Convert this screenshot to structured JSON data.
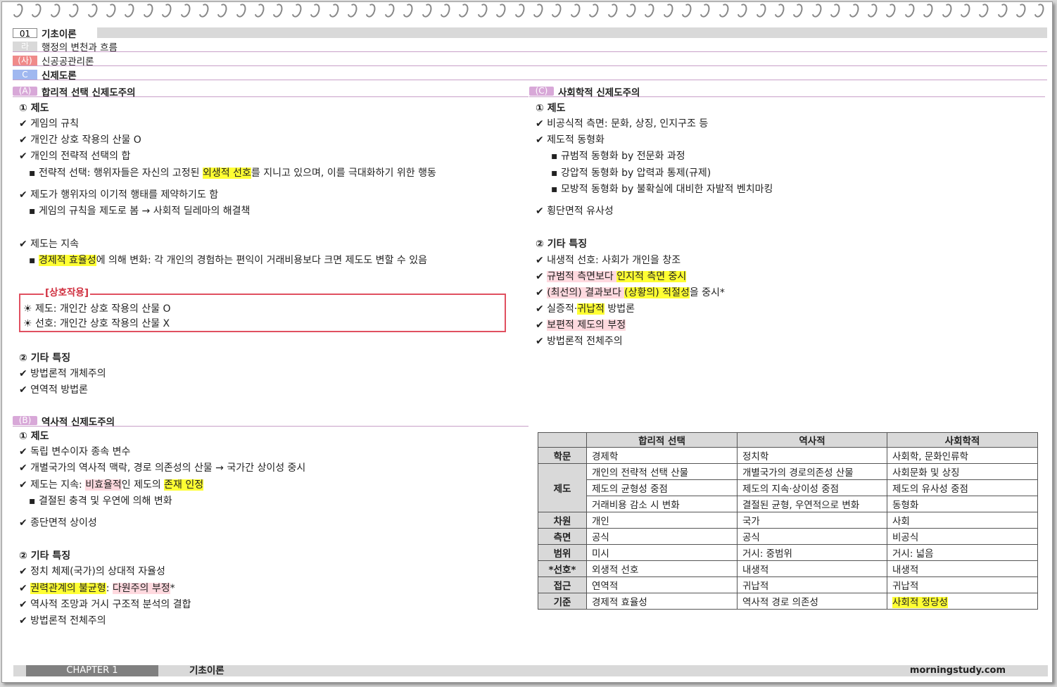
{
  "header": {
    "chapter_num": "01",
    "chapter_title": "기초이론",
    "sub1_tag": "라",
    "sub1_title": "행정의 변천과 흐름",
    "sub2_tag": "(사)",
    "sub2_title": "신공공관리론",
    "sub3_tag": "C",
    "sub3_title": "신제도론"
  },
  "left": {
    "a_tag": "(A)",
    "a_title": "합리적 선택 신제도주의",
    "a_h1": "① 제도",
    "a_l1": "✔ 게임의 규칙",
    "a_l2": "✔ 개인간 상호 작용의 산물 O",
    "a_l3": "✔ 개인의 전략적 선택의 합",
    "a_l4a": "▪ 전략적 선택: 행위자들은 자신의 고정된 ",
    "a_l4b": "외생적 선호",
    "a_l4c": "를 지니고 있으며, 이를 극대화하기 위한 행동",
    "a_l5": "✔ 제도가 행위자의 이기적 행태를 제약하기도 함",
    "a_l6": "▪ 게임의 규칙을 제도로 봄 → 사회적 딜레마의 해결책",
    "a_l7": "✔ 제도는 지속",
    "a_l8a": "▪ ",
    "a_l8b": "경제적 효율성",
    "a_l8c": "에 의해 변화: 각 개인의 경험하는 편익이 거래비용보다 크면 제도도 변할 수 있음",
    "box_title": "[상호작용]",
    "box_l1": "☀ 제도: 개인간 상호 작용의 산물 O",
    "box_l2": "☀ 선호: 개인간 상호 작용의 산물 X",
    "a_h2": "② 기타 특징",
    "a_l9": "✔ 방법론적 개체주의",
    "a_l10": "✔ 연역적 방법론",
    "b_tag": "(B)",
    "b_title": "역사적 신제도주의",
    "b_h1": "① 제도",
    "b_l1": "✔ 독립 변수이자 종속 변수",
    "b_l2": "✔ 개별국가의 역사적 맥락, 경로 의존성의 산물 → 국가간 상이성 중시",
    "b_l3a": "✔ 제도는 지속: ",
    "b_l3b": "비효율적",
    "b_l3c": "인 제도의 ",
    "b_l3d": "존재 인정",
    "b_l4": "▪ 결절된 충격 및 우연에 의해 변화",
    "b_l5": "✔ 종단면적 상이성",
    "b_h2": "② 기타 특징",
    "b_l6": "✔ 정치 체제(국가)의 상대적 자율성",
    "b_l7a": "✔ ",
    "b_l7b": "권력관계의 불균형",
    "b_l7c": ": ",
    "b_l7d": "다원주의 부정",
    "b_l7e": "*",
    "b_l8": "✔ 역사적 조망과 거시 구조적 분석의 결합",
    "b_l9": "✔ 방법론적 전체주의"
  },
  "right": {
    "c_tag": "(C)",
    "c_title": "사회학적 신제도주의",
    "c_h1": "① 제도",
    "c_l1": "✔ 비공식적 측면: 문화, 상징, 인지구조 등",
    "c_l2": "✔ 제도적 동형화",
    "c_l3": "▪ 규범적 동형화 by 전문화 과정",
    "c_l4": "▪ 강압적 동형화 by 압력과 통제(규제)",
    "c_l5": "▪ 모방적 동형화 by 불확실에 대비한 자발적 벤치마킹",
    "c_l6": "✔ 횡단면적 유사성",
    "c_h2": "② 기타 특징",
    "c_l7": "✔ 내생적 선호: 사회가 개인을 창조",
    "c_l8a": "✔ ",
    "c_l8b": "규범적 측면보다 ",
    "c_l8c": "인지적 측면 중시",
    "c_l9a": "✔ ",
    "c_l9b": "(최선의) 결과보다 ",
    "c_l9c": "(상황의) 적절성",
    "c_l9d": "을 중시*",
    "c_l10a": "✔ 실증적·",
    "c_l10b": "귀납적",
    "c_l10c": " 방법론",
    "c_l11a": "✔ ",
    "c_l11b": "보편적 제도의 부정",
    "c_l12": "✔ 방법론적 전체주의"
  },
  "table": {
    "headers": [
      "",
      "합리적 선택",
      "역사적",
      "사회학적"
    ],
    "r_hakmun": [
      "학문",
      "경제학",
      "정치학",
      "사회학, 문화인류학"
    ],
    "r_jedo_label": "제도",
    "r_jedo1": [
      "개인의 전략적 선택 산물",
      "개별국가의 경로의존성 산물",
      "사회문화 및 상징"
    ],
    "r_jedo2": [
      "제도의 균형성 중점",
      "제도의 지속·상이성 중점",
      "제도의 유사성 중점"
    ],
    "r_jedo3": [
      "거래비용 감소 시 변화",
      "결절된 균형, 우연적으로 변화",
      "동형화"
    ],
    "r_chawon": [
      "차원",
      "개인",
      "국가",
      "사회"
    ],
    "r_cheukmyeon": [
      "측면",
      "공식",
      "공식",
      "비공식"
    ],
    "r_beomwi": [
      "범위",
      "미시",
      "거시: 중범위",
      "거시: 넓음"
    ],
    "r_seonho": [
      "*선호*",
      "외생적 선호",
      "내생적",
      "내생적"
    ],
    "r_jeopgeun": [
      "접근",
      "연역적",
      "귀납적",
      "귀납적"
    ],
    "r_gijun": [
      "기준",
      "경제적 효율성",
      "역사적 경로 의존성",
      "사회적 정당성"
    ]
  },
  "footer": {
    "chapter": "CHAPTER 1",
    "title": "기초이론",
    "site": "morningstudy.com"
  }
}
